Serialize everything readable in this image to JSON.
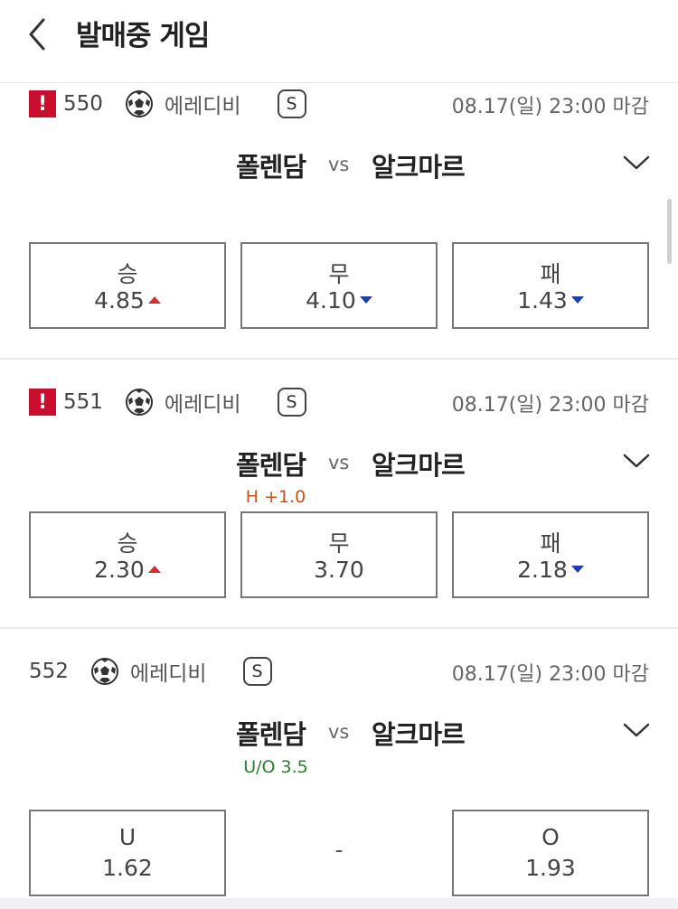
{
  "header": {
    "title": "발매중 게임"
  },
  "games": [
    {
      "alert": "!",
      "number": "550",
      "league": "에레디비",
      "type_badge": "S",
      "deadline": "08.17(일) 23:00 마감",
      "home": "폴렌담",
      "vs": "vs",
      "away": "알크마르",
      "handicap": "",
      "odds": [
        {
          "label": "승",
          "value": "4.85",
          "trend": "up"
        },
        {
          "label": "무",
          "value": "4.10",
          "trend": "down"
        },
        {
          "label": "패",
          "value": "1.43",
          "trend": "down"
        }
      ]
    },
    {
      "alert": "!",
      "number": "551",
      "league": "에레디비",
      "type_badge": "S",
      "deadline": "08.17(일) 23:00 마감",
      "home": "폴렌담",
      "vs": "vs",
      "away": "알크마르",
      "handicap": "H +1.0",
      "handicap_color": "#c8501a",
      "odds": [
        {
          "label": "승",
          "value": "2.30",
          "trend": "up"
        },
        {
          "label": "무",
          "value": "3.70",
          "trend": "none"
        },
        {
          "label": "패",
          "value": "2.18",
          "trend": "down"
        }
      ]
    },
    {
      "alert": "",
      "number": "552",
      "league": "에레디비",
      "type_badge": "S",
      "deadline": "08.17(일) 23:00 마감",
      "home": "폴렌담",
      "vs": "vs",
      "away": "알크마르",
      "handicap": "U/O 3.5",
      "handicap_color": "#2e7d32",
      "odds": [
        {
          "label": "U",
          "value": "1.62",
          "trend": "none"
        },
        {
          "label": "-",
          "value": "",
          "trend": "none"
        },
        {
          "label": "O",
          "value": "1.93",
          "trend": "none"
        }
      ]
    }
  ],
  "colors": {
    "alert": "#c8102e",
    "up": "#d32f2f",
    "down": "#1e3ea8"
  }
}
